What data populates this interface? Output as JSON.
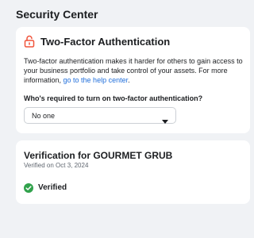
{
  "page": {
    "title": "Security Center"
  },
  "two_factor": {
    "title": "Two-Factor Authentication",
    "description": "Two-factor authentication makes it harder for others to gain access to your business portfolio and take control of your assets. For more information, ",
    "link_text": "go to the help center",
    "description_end": ".",
    "question": "Who's required to turn on two-factor authentication?",
    "selected_option": "No one",
    "icon": "lock-open-icon"
  },
  "verification": {
    "title": "Verification for GOURMET GRUB",
    "date": "Verified on Oct 3, 2024",
    "status": "Verified",
    "icon": "check-circle-icon"
  },
  "colors": {
    "accent_link": "#216fdb",
    "lock_icon": "#f0533a",
    "verified_green": "#31a24c",
    "background": "#f0f2f5"
  }
}
